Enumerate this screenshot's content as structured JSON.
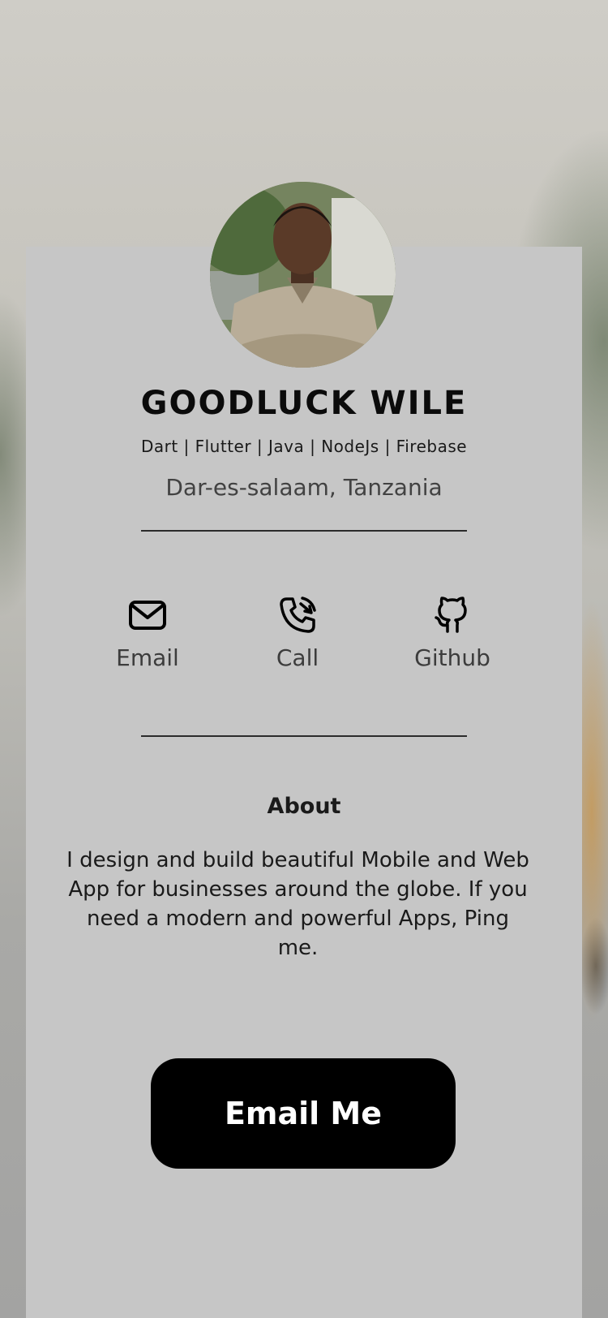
{
  "profile": {
    "name": "GOODLUCK WILE",
    "skills": "Dart | Flutter | Java | NodeJs | Firebase",
    "location": "Dar-es-salaam, Tanzania"
  },
  "contacts": [
    {
      "label": "Email",
      "icon": "envelope-icon"
    },
    {
      "label": "Call",
      "icon": "phone-call-icon"
    },
    {
      "label": "Github",
      "icon": "github-icon"
    }
  ],
  "about": {
    "title": "About",
    "text": "I design and build beautiful Mobile and Web App for businesses around the globe. If you need a modern and powerful Apps, Ping me."
  },
  "cta": {
    "label": "Email Me"
  },
  "colors": {
    "card": "#c6c6c6",
    "button": "#000000",
    "button_text": "#ffffff"
  }
}
